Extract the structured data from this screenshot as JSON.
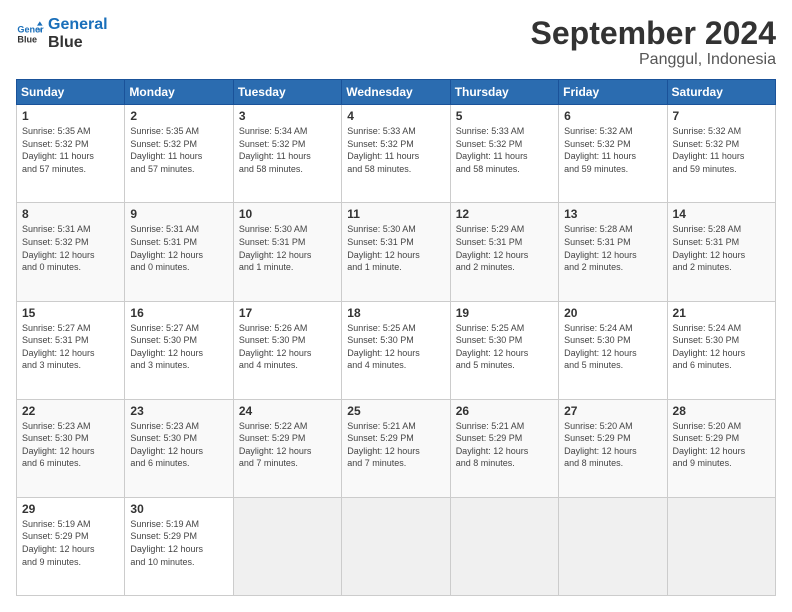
{
  "logo": {
    "line1": "General",
    "line2": "Blue"
  },
  "title": "September 2024",
  "subtitle": "Panggul, Indonesia",
  "header_days": [
    "Sunday",
    "Monday",
    "Tuesday",
    "Wednesday",
    "Thursday",
    "Friday",
    "Saturday"
  ],
  "weeks": [
    [
      {
        "num": "1",
        "info": "Sunrise: 5:35 AM\nSunset: 5:32 PM\nDaylight: 11 hours\nand 57 minutes."
      },
      {
        "num": "2",
        "info": "Sunrise: 5:35 AM\nSunset: 5:32 PM\nDaylight: 11 hours\nand 57 minutes."
      },
      {
        "num": "3",
        "info": "Sunrise: 5:34 AM\nSunset: 5:32 PM\nDaylight: 11 hours\nand 58 minutes."
      },
      {
        "num": "4",
        "info": "Sunrise: 5:33 AM\nSunset: 5:32 PM\nDaylight: 11 hours\nand 58 minutes."
      },
      {
        "num": "5",
        "info": "Sunrise: 5:33 AM\nSunset: 5:32 PM\nDaylight: 11 hours\nand 58 minutes."
      },
      {
        "num": "6",
        "info": "Sunrise: 5:32 AM\nSunset: 5:32 PM\nDaylight: 11 hours\nand 59 minutes."
      },
      {
        "num": "7",
        "info": "Sunrise: 5:32 AM\nSunset: 5:32 PM\nDaylight: 11 hours\nand 59 minutes."
      }
    ],
    [
      {
        "num": "8",
        "info": "Sunrise: 5:31 AM\nSunset: 5:32 PM\nDaylight: 12 hours\nand 0 minutes."
      },
      {
        "num": "9",
        "info": "Sunrise: 5:31 AM\nSunset: 5:31 PM\nDaylight: 12 hours\nand 0 minutes."
      },
      {
        "num": "10",
        "info": "Sunrise: 5:30 AM\nSunset: 5:31 PM\nDaylight: 12 hours\nand 1 minute."
      },
      {
        "num": "11",
        "info": "Sunrise: 5:30 AM\nSunset: 5:31 PM\nDaylight: 12 hours\nand 1 minute."
      },
      {
        "num": "12",
        "info": "Sunrise: 5:29 AM\nSunset: 5:31 PM\nDaylight: 12 hours\nand 2 minutes."
      },
      {
        "num": "13",
        "info": "Sunrise: 5:28 AM\nSunset: 5:31 PM\nDaylight: 12 hours\nand 2 minutes."
      },
      {
        "num": "14",
        "info": "Sunrise: 5:28 AM\nSunset: 5:31 PM\nDaylight: 12 hours\nand 2 minutes."
      }
    ],
    [
      {
        "num": "15",
        "info": "Sunrise: 5:27 AM\nSunset: 5:31 PM\nDaylight: 12 hours\nand 3 minutes."
      },
      {
        "num": "16",
        "info": "Sunrise: 5:27 AM\nSunset: 5:30 PM\nDaylight: 12 hours\nand 3 minutes."
      },
      {
        "num": "17",
        "info": "Sunrise: 5:26 AM\nSunset: 5:30 PM\nDaylight: 12 hours\nand 4 minutes."
      },
      {
        "num": "18",
        "info": "Sunrise: 5:25 AM\nSunset: 5:30 PM\nDaylight: 12 hours\nand 4 minutes."
      },
      {
        "num": "19",
        "info": "Sunrise: 5:25 AM\nSunset: 5:30 PM\nDaylight: 12 hours\nand 5 minutes."
      },
      {
        "num": "20",
        "info": "Sunrise: 5:24 AM\nSunset: 5:30 PM\nDaylight: 12 hours\nand 5 minutes."
      },
      {
        "num": "21",
        "info": "Sunrise: 5:24 AM\nSunset: 5:30 PM\nDaylight: 12 hours\nand 6 minutes."
      }
    ],
    [
      {
        "num": "22",
        "info": "Sunrise: 5:23 AM\nSunset: 5:30 PM\nDaylight: 12 hours\nand 6 minutes."
      },
      {
        "num": "23",
        "info": "Sunrise: 5:23 AM\nSunset: 5:30 PM\nDaylight: 12 hours\nand 6 minutes."
      },
      {
        "num": "24",
        "info": "Sunrise: 5:22 AM\nSunset: 5:29 PM\nDaylight: 12 hours\nand 7 minutes."
      },
      {
        "num": "25",
        "info": "Sunrise: 5:21 AM\nSunset: 5:29 PM\nDaylight: 12 hours\nand 7 minutes."
      },
      {
        "num": "26",
        "info": "Sunrise: 5:21 AM\nSunset: 5:29 PM\nDaylight: 12 hours\nand 8 minutes."
      },
      {
        "num": "27",
        "info": "Sunrise: 5:20 AM\nSunset: 5:29 PM\nDaylight: 12 hours\nand 8 minutes."
      },
      {
        "num": "28",
        "info": "Sunrise: 5:20 AM\nSunset: 5:29 PM\nDaylight: 12 hours\nand 9 minutes."
      }
    ],
    [
      {
        "num": "29",
        "info": "Sunrise: 5:19 AM\nSunset: 5:29 PM\nDaylight: 12 hours\nand 9 minutes."
      },
      {
        "num": "30",
        "info": "Sunrise: 5:19 AM\nSunset: 5:29 PM\nDaylight: 12 hours\nand 10 minutes."
      },
      {
        "num": "",
        "info": ""
      },
      {
        "num": "",
        "info": ""
      },
      {
        "num": "",
        "info": ""
      },
      {
        "num": "",
        "info": ""
      },
      {
        "num": "",
        "info": ""
      }
    ]
  ]
}
